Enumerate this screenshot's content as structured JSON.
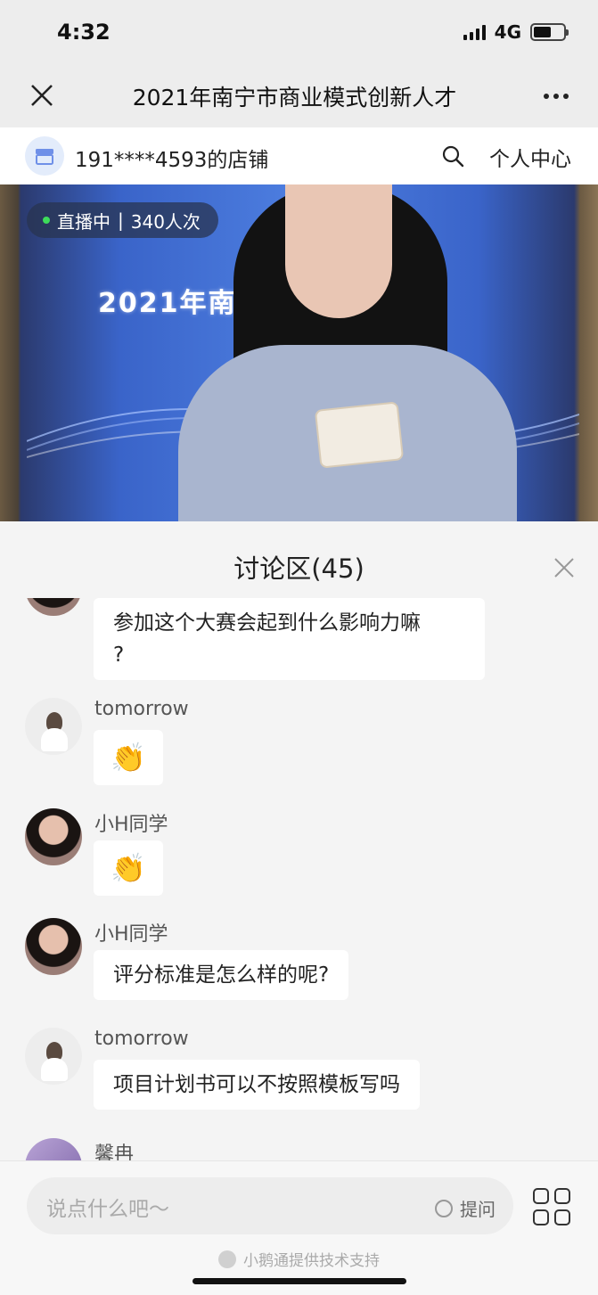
{
  "status_bar": {
    "time": "4:32",
    "network": "4G",
    "battery_level": 0.6
  },
  "nav": {
    "title": "2021年南宁市商业模式创新人才"
  },
  "shop": {
    "name": "191****4593的店铺",
    "center_label": "个人中心"
  },
  "video": {
    "live_status": "直播中",
    "separator": "|",
    "viewers": "340人次",
    "screen_text": "2021年南宁市          人才大赛"
  },
  "discussion": {
    "title": "讨论区(45)",
    "messages": [
      {
        "name": "",
        "text": "参加这个大赛会起到什么影响力嘛\n?"
      },
      {
        "name": "tomorrow",
        "text": "👏"
      },
      {
        "name": "小H同学",
        "text": "👏"
      },
      {
        "name": "小H同学",
        "text": "评分标准是怎么样的呢?"
      },
      {
        "name": "tomorrow",
        "text": "项目计划书可以不按照模板写吗"
      },
      {
        "name": "馨冉",
        "text": ""
      }
    ]
  },
  "input": {
    "placeholder": "说点什么吧～",
    "ask_label": "提问"
  },
  "footer": {
    "powered_by": "小鹅通提供技术支持"
  },
  "colors": {
    "live_dot": "#3ddc5a",
    "nav_bg": "#ededed",
    "panel_bg": "#f4f4f4"
  }
}
